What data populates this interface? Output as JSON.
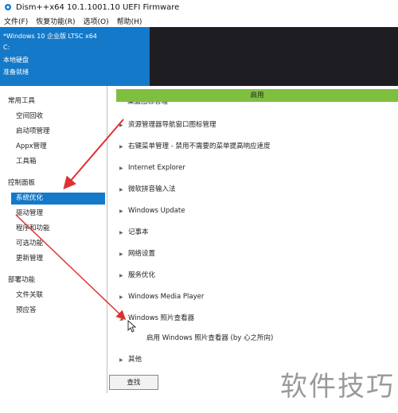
{
  "window": {
    "title": "Dism++x64 10.1.1001.10 UEFI Firmware"
  },
  "menubar": [
    "文件(F)",
    "恢复功能(R)",
    "选项(O)",
    "帮助(H)"
  ],
  "info": {
    "system": "*Windows 10 企业版 LTSC x64",
    "drive": "C:",
    "disk": "本地硬盘",
    "status": "准备就绪"
  },
  "sidebar": {
    "section_tools": "常用工具",
    "tools": [
      "空间回收",
      "启动项管理",
      "Appx管理",
      "工具箱"
    ],
    "section_control": "控制面板",
    "control": [
      "系统优化",
      "驱动管理",
      "程序和功能",
      "可选功能",
      "更新管理"
    ],
    "section_deploy": "部署功能",
    "deploy": [
      "文件关联",
      "预应答"
    ]
  },
  "main": {
    "header": "启用",
    "partial_top": "桌面图标管理",
    "options": [
      "资源管理器导航窗口图标管理",
      "右键菜单管理 - 禁用不需要的菜单提高响应速度",
      "Internet Explorer",
      "微软拼音输入法",
      "Windows Update",
      "记事本",
      "网络设置",
      "服务优化",
      "Windows Media Player",
      "Windows 照片查看器"
    ],
    "sub_option": "启用 Windows 照片查看器 (by 心之所向)",
    "last_option": "其他",
    "search_label": "查找"
  },
  "watermark": "软件技巧",
  "colors": {
    "accent_blue": "#1479c9",
    "header_green": "#7fbf3f",
    "dark_panel": "#1e1e22",
    "arrow_red": "#e03030"
  }
}
